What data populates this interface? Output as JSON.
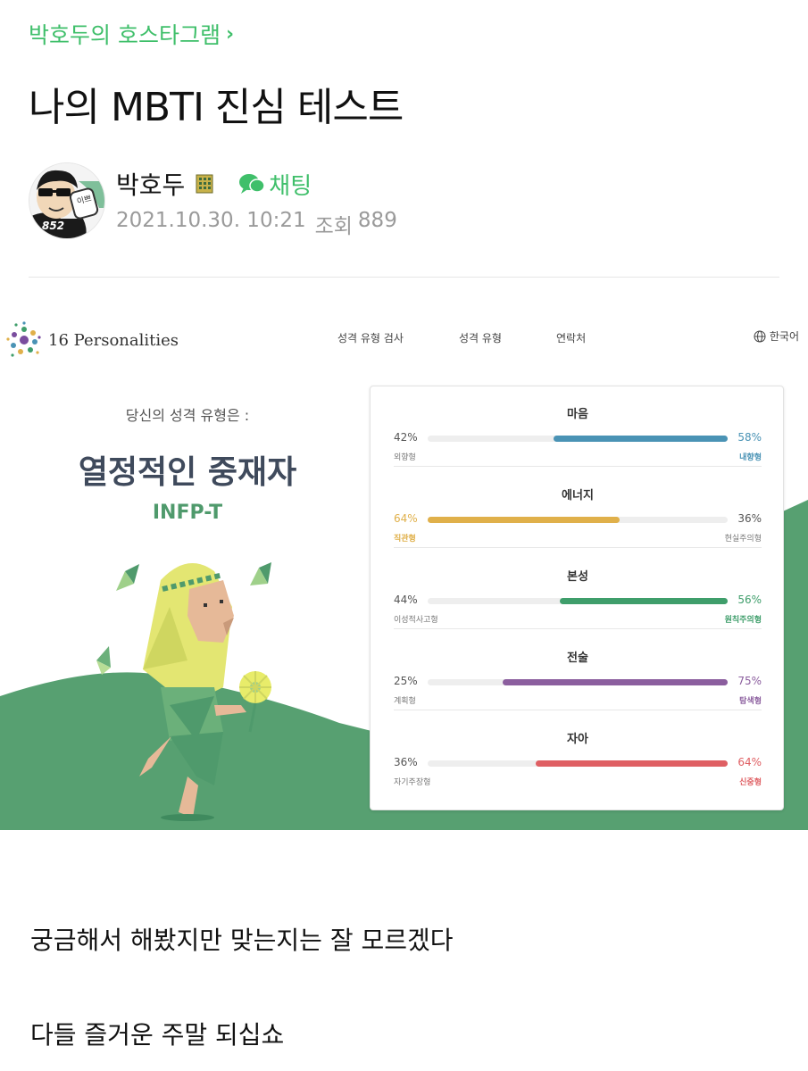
{
  "cafe": {
    "name": "박호두의 호스타그램"
  },
  "post": {
    "title": "나의 MBTI 진심 테스트",
    "author": "박호두",
    "avatar_number": "852",
    "chat_label": "채팅",
    "date": "2021.10.30. 10:21",
    "views_label": "조회",
    "views": "889",
    "paragraphs": [
      "궁금해서 해봤지만 맞는지는 잘 모르겠다",
      "다들 즐거운 주말 되십쇼"
    ]
  },
  "embed": {
    "logo_number": "16",
    "logo_word": "Personalities",
    "nav": [
      "성격 유형 검사",
      "성격 유형",
      "연락처"
    ],
    "language": "한국어",
    "result_lead": "당신의 성격 유형은 :",
    "result_name": "열정적인 중재자",
    "result_code": "INFP-T",
    "traits": [
      {
        "title": "마음",
        "left_pct": "42%",
        "right_pct": "58%",
        "left_label": "외향형",
        "right_label": "내향형",
        "dominant": "right",
        "value": 58,
        "color": "#4a93b5"
      },
      {
        "title": "에너지",
        "left_pct": "64%",
        "right_pct": "36%",
        "left_label": "직관형",
        "right_label": "현실주의형",
        "dominant": "left",
        "value": 64,
        "color": "#e0b04a"
      },
      {
        "title": "본성",
        "left_pct": "44%",
        "right_pct": "56%",
        "left_label": "이성적사고형",
        "right_label": "원칙주의형",
        "dominant": "right",
        "value": 56,
        "color": "#3f9e6b"
      },
      {
        "title": "전술",
        "left_pct": "25%",
        "right_pct": "75%",
        "left_label": "계획형",
        "right_label": "탐색형",
        "dominant": "right",
        "value": 75,
        "color": "#8b5e9e"
      },
      {
        "title": "자아",
        "left_pct": "36%",
        "right_pct": "64%",
        "left_label": "자기주장형",
        "right_label": "신중형",
        "dominant": "right",
        "value": 64,
        "color": "#df5f63"
      }
    ]
  },
  "colors": {
    "cafe_green": "#3fbf6a",
    "hill_green": "#57a071",
    "type_green": "#4f9a6c"
  },
  "icons": [
    "chevron-right-icon",
    "rank-badge-icon",
    "chat-bubble-icon",
    "logo-dots-icon",
    "globe-icon"
  ]
}
